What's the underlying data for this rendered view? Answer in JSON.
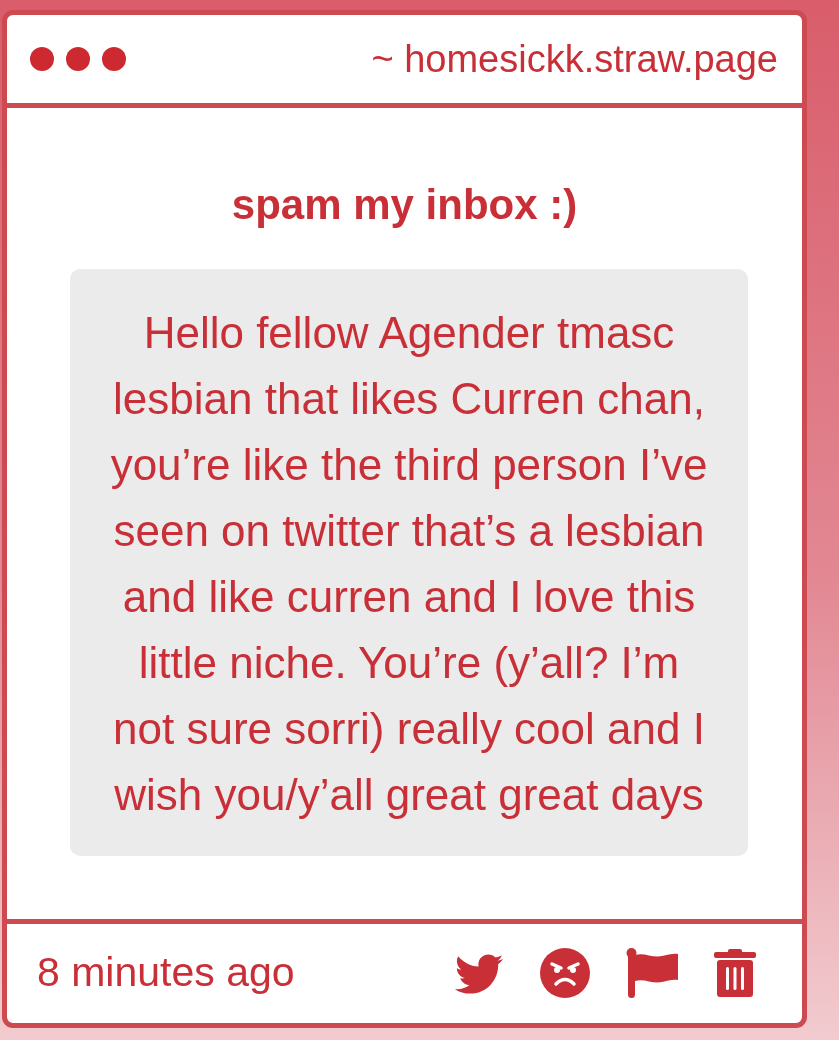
{
  "window": {
    "url": "~ homesickk.straw.page"
  },
  "prompt": {
    "title": "spam my inbox :)"
  },
  "message": {
    "text": "Hello fellow Agender tmasc lesbian that likes Curren chan, you’re like the third person I’ve seen on twitter that’s a lesbian and like curren and I love this little niche. You’re (y’all? I’m not sure sorri) really cool and I wish you/y’all great great days"
  },
  "footer": {
    "timestamp": "8 minutes ago"
  }
}
